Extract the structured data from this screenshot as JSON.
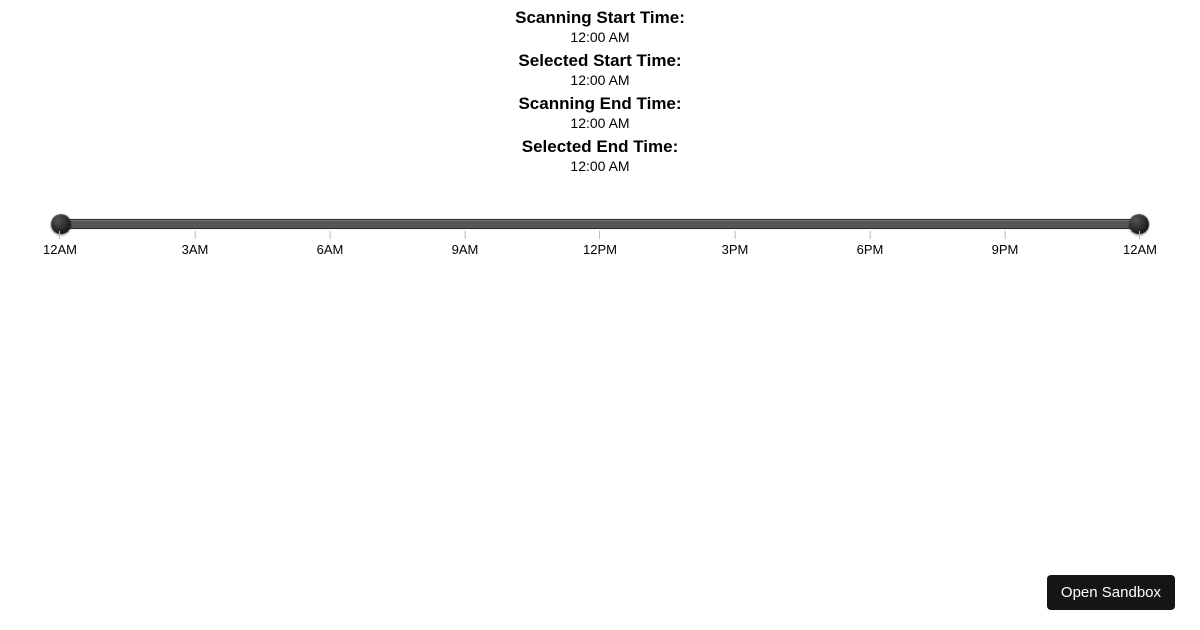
{
  "info": {
    "rows": [
      {
        "label": "Scanning Start Time:",
        "value": "12:00 AM"
      },
      {
        "label": "Selected Start Time:",
        "value": "12:00 AM"
      },
      {
        "label": "Scanning End Time:",
        "value": "12:00 AM"
      },
      {
        "label": "Selected End Time:",
        "value": "12:00 AM"
      }
    ]
  },
  "slider": {
    "start_percent": 0,
    "end_percent": 100,
    "ticks": [
      {
        "label": "12AM",
        "percent": 0
      },
      {
        "label": "3AM",
        "percent": 12.5
      },
      {
        "label": "6AM",
        "percent": 25
      },
      {
        "label": "9AM",
        "percent": 37.5
      },
      {
        "label": "12PM",
        "percent": 50
      },
      {
        "label": "3PM",
        "percent": 62.5
      },
      {
        "label": "6PM",
        "percent": 75
      },
      {
        "label": "9PM",
        "percent": 87.5
      },
      {
        "label": "12AM",
        "percent": 100
      }
    ]
  },
  "sandbox": {
    "label": "Open Sandbox"
  }
}
